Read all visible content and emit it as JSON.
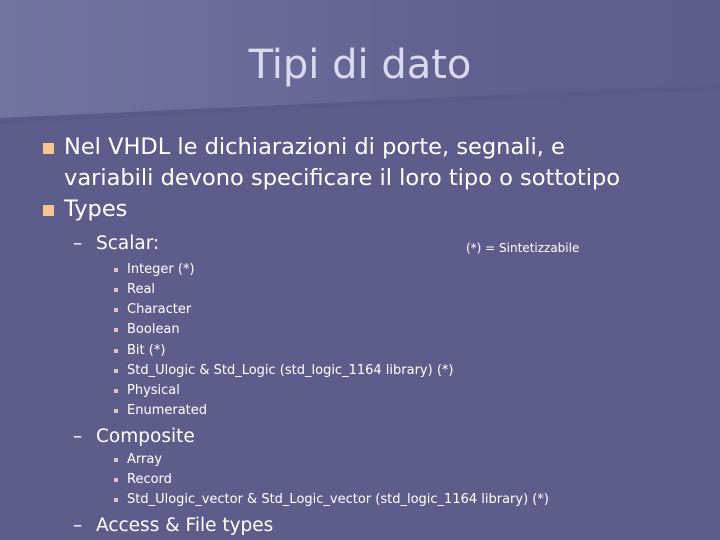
{
  "slide": {
    "title": "Tipi di dato",
    "bullets": [
      {
        "line1": "Nel VHDL le dichiarazioni di porte, segnali, e",
        "line2": "variabili devono specificare il loro tipo o sottotipo"
      },
      {
        "text": "Types"
      }
    ],
    "note": "(*) = Sintetizzabile",
    "dash_symbol": "–",
    "sections": [
      {
        "label": "Scalar:",
        "items": [
          "Integer (*)",
          "Real",
          "Character",
          "Boolean",
          "Bit (*)",
          "Std_Ulogic & Std_Logic (std_logic_1164 library) (*)",
          "Physical",
          "Enumerated"
        ]
      },
      {
        "label": "Composite",
        "items": [
          "Array",
          "Record",
          "Std_Ulogic_vector & Std_Logic_vector (std_logic_1164 library) (*)"
        ]
      },
      {
        "label": "Access & File types",
        "items": []
      }
    ]
  },
  "colors": {
    "background": "#5d5d8b",
    "title_text": "#d9d9ef",
    "body_text": "#ffffff",
    "bullet_primary": "#f8c48e",
    "bullet_secondary": "#e8c0c0"
  }
}
